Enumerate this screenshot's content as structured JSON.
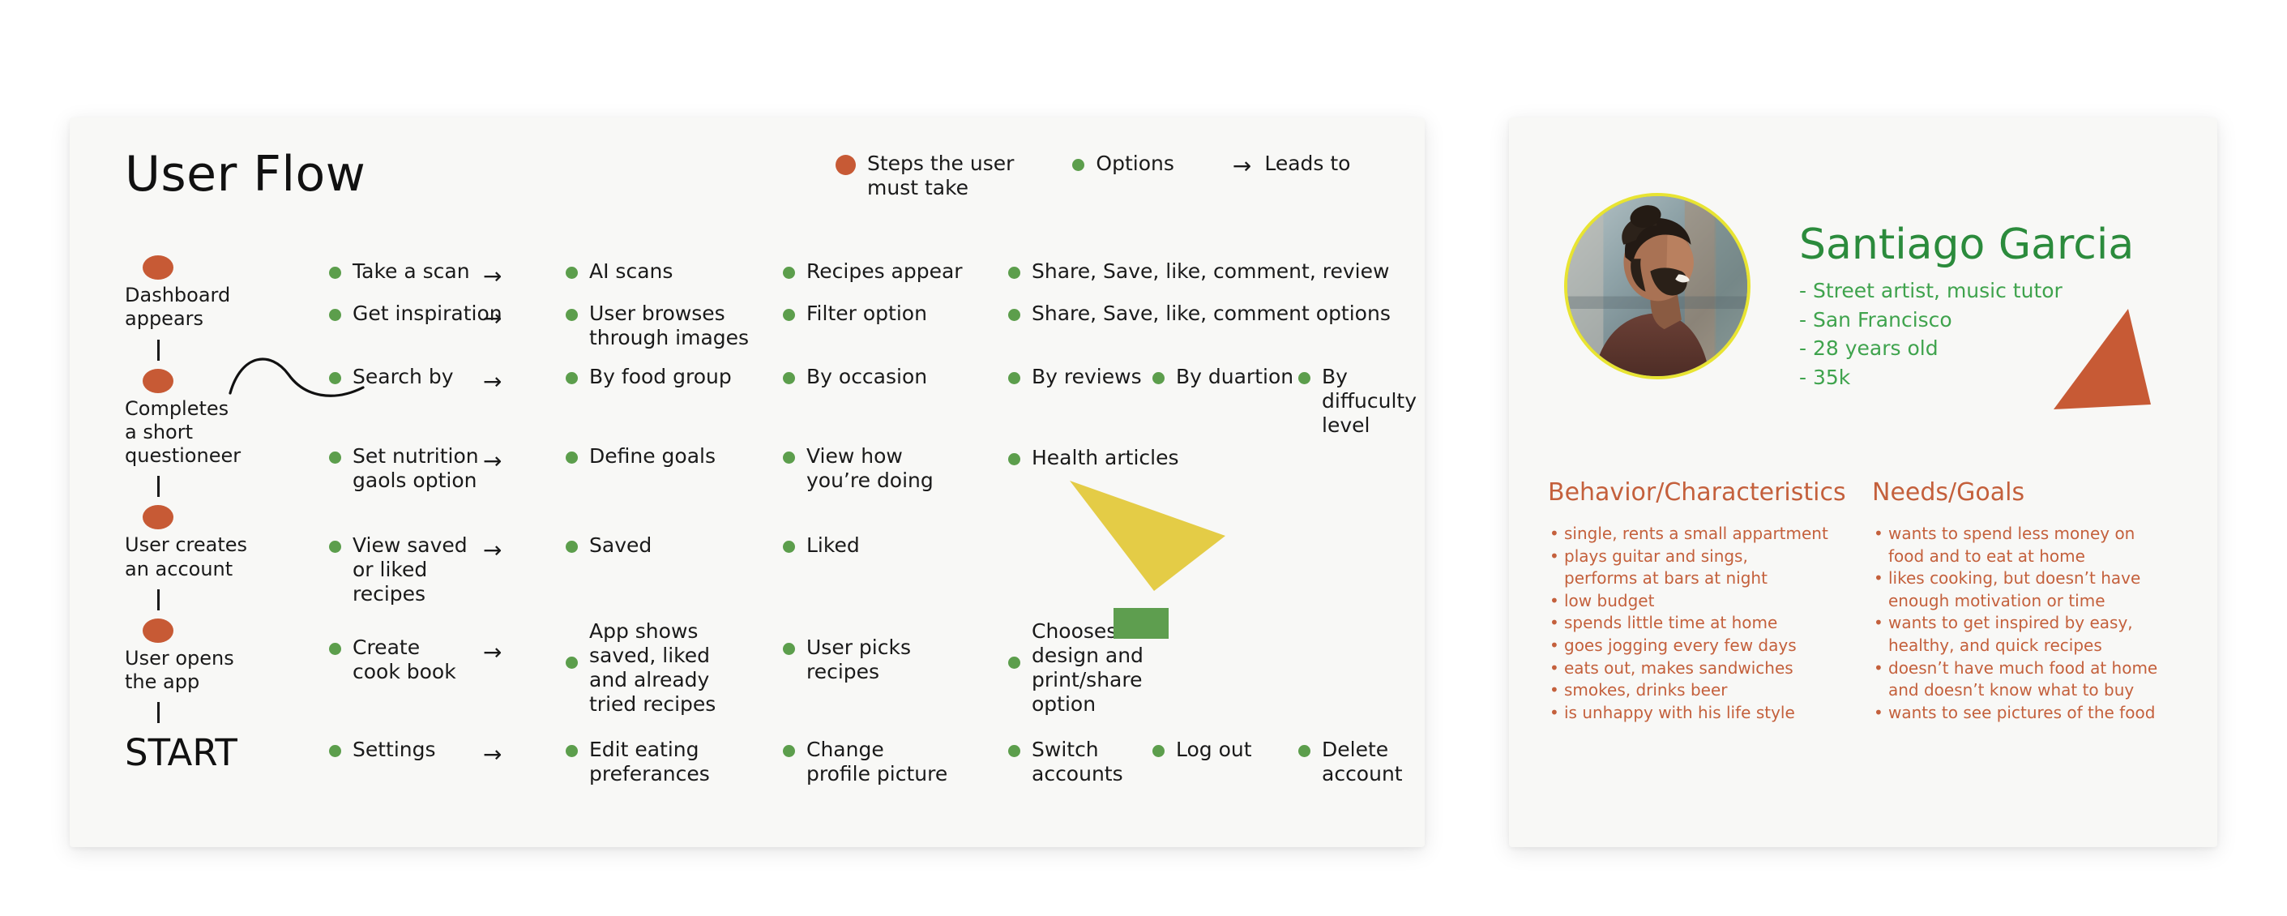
{
  "flow": {
    "title": "User Flow",
    "start_label": "START",
    "legend": [
      {
        "marker": "red-dot",
        "label": "Steps the user\nmust take"
      },
      {
        "marker": "green-dot",
        "label": "Options"
      },
      {
        "marker": "arrow",
        "label": "Leads to"
      }
    ],
    "chain": [
      "Dashboard\nappears",
      "Completes\na short\nquestioneer",
      "User creates\nan account",
      "User opens\nthe app"
    ],
    "rows": [
      {
        "c1": "Take a scan",
        "arrow": "→",
        "c2": "AI scans",
        "c3": "Recipes appear",
        "c4": "Share, Save, like, comment, review",
        "c5": "",
        "c6": ""
      },
      {
        "c1": "Get inspiration",
        "arrow": "→",
        "c2": "User browses\nthrough images",
        "c3": "Filter option",
        "c4": "Share, Save, like, comment options",
        "c5": "",
        "c6": ""
      },
      {
        "c1": "Search by",
        "arrow": "→",
        "c2": "By food group",
        "c3": "By occasion",
        "c4": "By reviews",
        "c5": "By duartion",
        "c6": "By diffuculty\nlevel"
      },
      {
        "c1": "Set nutrition\ngaols option",
        "arrow": "→",
        "c2": "Define goals",
        "c3": "View how\nyou’re doing",
        "c4": "Health articles",
        "c5": "",
        "c6": ""
      },
      {
        "c1": "View saved\nor liked\nrecipes",
        "arrow": "→",
        "c2": "Saved",
        "c3": "Liked",
        "c4": "",
        "c5": "",
        "c6": ""
      },
      {
        "c1": "Create\ncook book",
        "arrow": "→",
        "c2": "App shows\nsaved, liked\nand already\ntried recipes",
        "c3": "User picks\nrecipes",
        "c4": "Chooses a\ndesign and\nprint/share\noption",
        "c5": "",
        "c6": ""
      },
      {
        "c1": "Settings",
        "arrow": "→",
        "c2": "Edit eating\npreferances",
        "c3": "Change\nprofile picture",
        "c4": "Switch\naccounts",
        "c5": "Log out",
        "c6": "Delete\naccount"
      }
    ]
  },
  "persona": {
    "name": "Santiago Garcia",
    "meta": [
      "- Street artist, music tutor",
      "- San Francisco",
      "- 28 years old",
      "- 35k"
    ],
    "behavior": {
      "heading": "Behavior/Characteristics",
      "items": [
        {
          "text": "single, rents a small appartment",
          "cont": false
        },
        {
          "text": "plays guitar and sings,",
          "cont": false
        },
        {
          "text": "performs at bars at night",
          "cont": true
        },
        {
          "text": "low budget",
          "cont": false
        },
        {
          "text": "spends little time at home",
          "cont": false
        },
        {
          "text": "goes jogging every few days",
          "cont": false
        },
        {
          "text": "eats out, makes sandwiches",
          "cont": false
        },
        {
          "text": "smokes, drinks beer",
          "cont": false
        },
        {
          "text": "is unhappy with his life style",
          "cont": false
        }
      ]
    },
    "needs": {
      "heading": "Needs/Goals",
      "items": [
        {
          "text": "wants to spend less money on",
          "cont": false
        },
        {
          "text": "food and to eat at home",
          "cont": true
        },
        {
          "text": "likes cooking, but doesn’t have",
          "cont": false
        },
        {
          "text": "enough motivation or time",
          "cont": true
        },
        {
          "text": "wants to get inspired by easy,",
          "cont": false
        },
        {
          "text": "healthy, and quick recipes",
          "cont": true
        },
        {
          "text": "doesn’t have much food at home",
          "cont": false
        },
        {
          "text": "and doesn’t know what to buy",
          "cont": true
        },
        {
          "text": "wants to see pictures of the food",
          "cont": false
        }
      ]
    }
  },
  "colors": {
    "orange": "#c75a35",
    "green_dot": "#5c9e4c",
    "green_rect": "#5e9e4f",
    "yellow": "#e4cc46",
    "ring_yellow": "#e8e432",
    "persona_green": "#3fa34d",
    "persona_name_green": "#2b8b3c",
    "persona_orange": "#c4603c",
    "card_bg": "#f8f8f6",
    "page_bg": "#ffffff",
    "text": "#1a1a1a"
  },
  "shapes": {
    "triangle_top_left": "orange-triangle",
    "triangle_mid": "yellow-triangle",
    "rect": "green-rectangle",
    "triangle_persona": "orange-triangle"
  }
}
